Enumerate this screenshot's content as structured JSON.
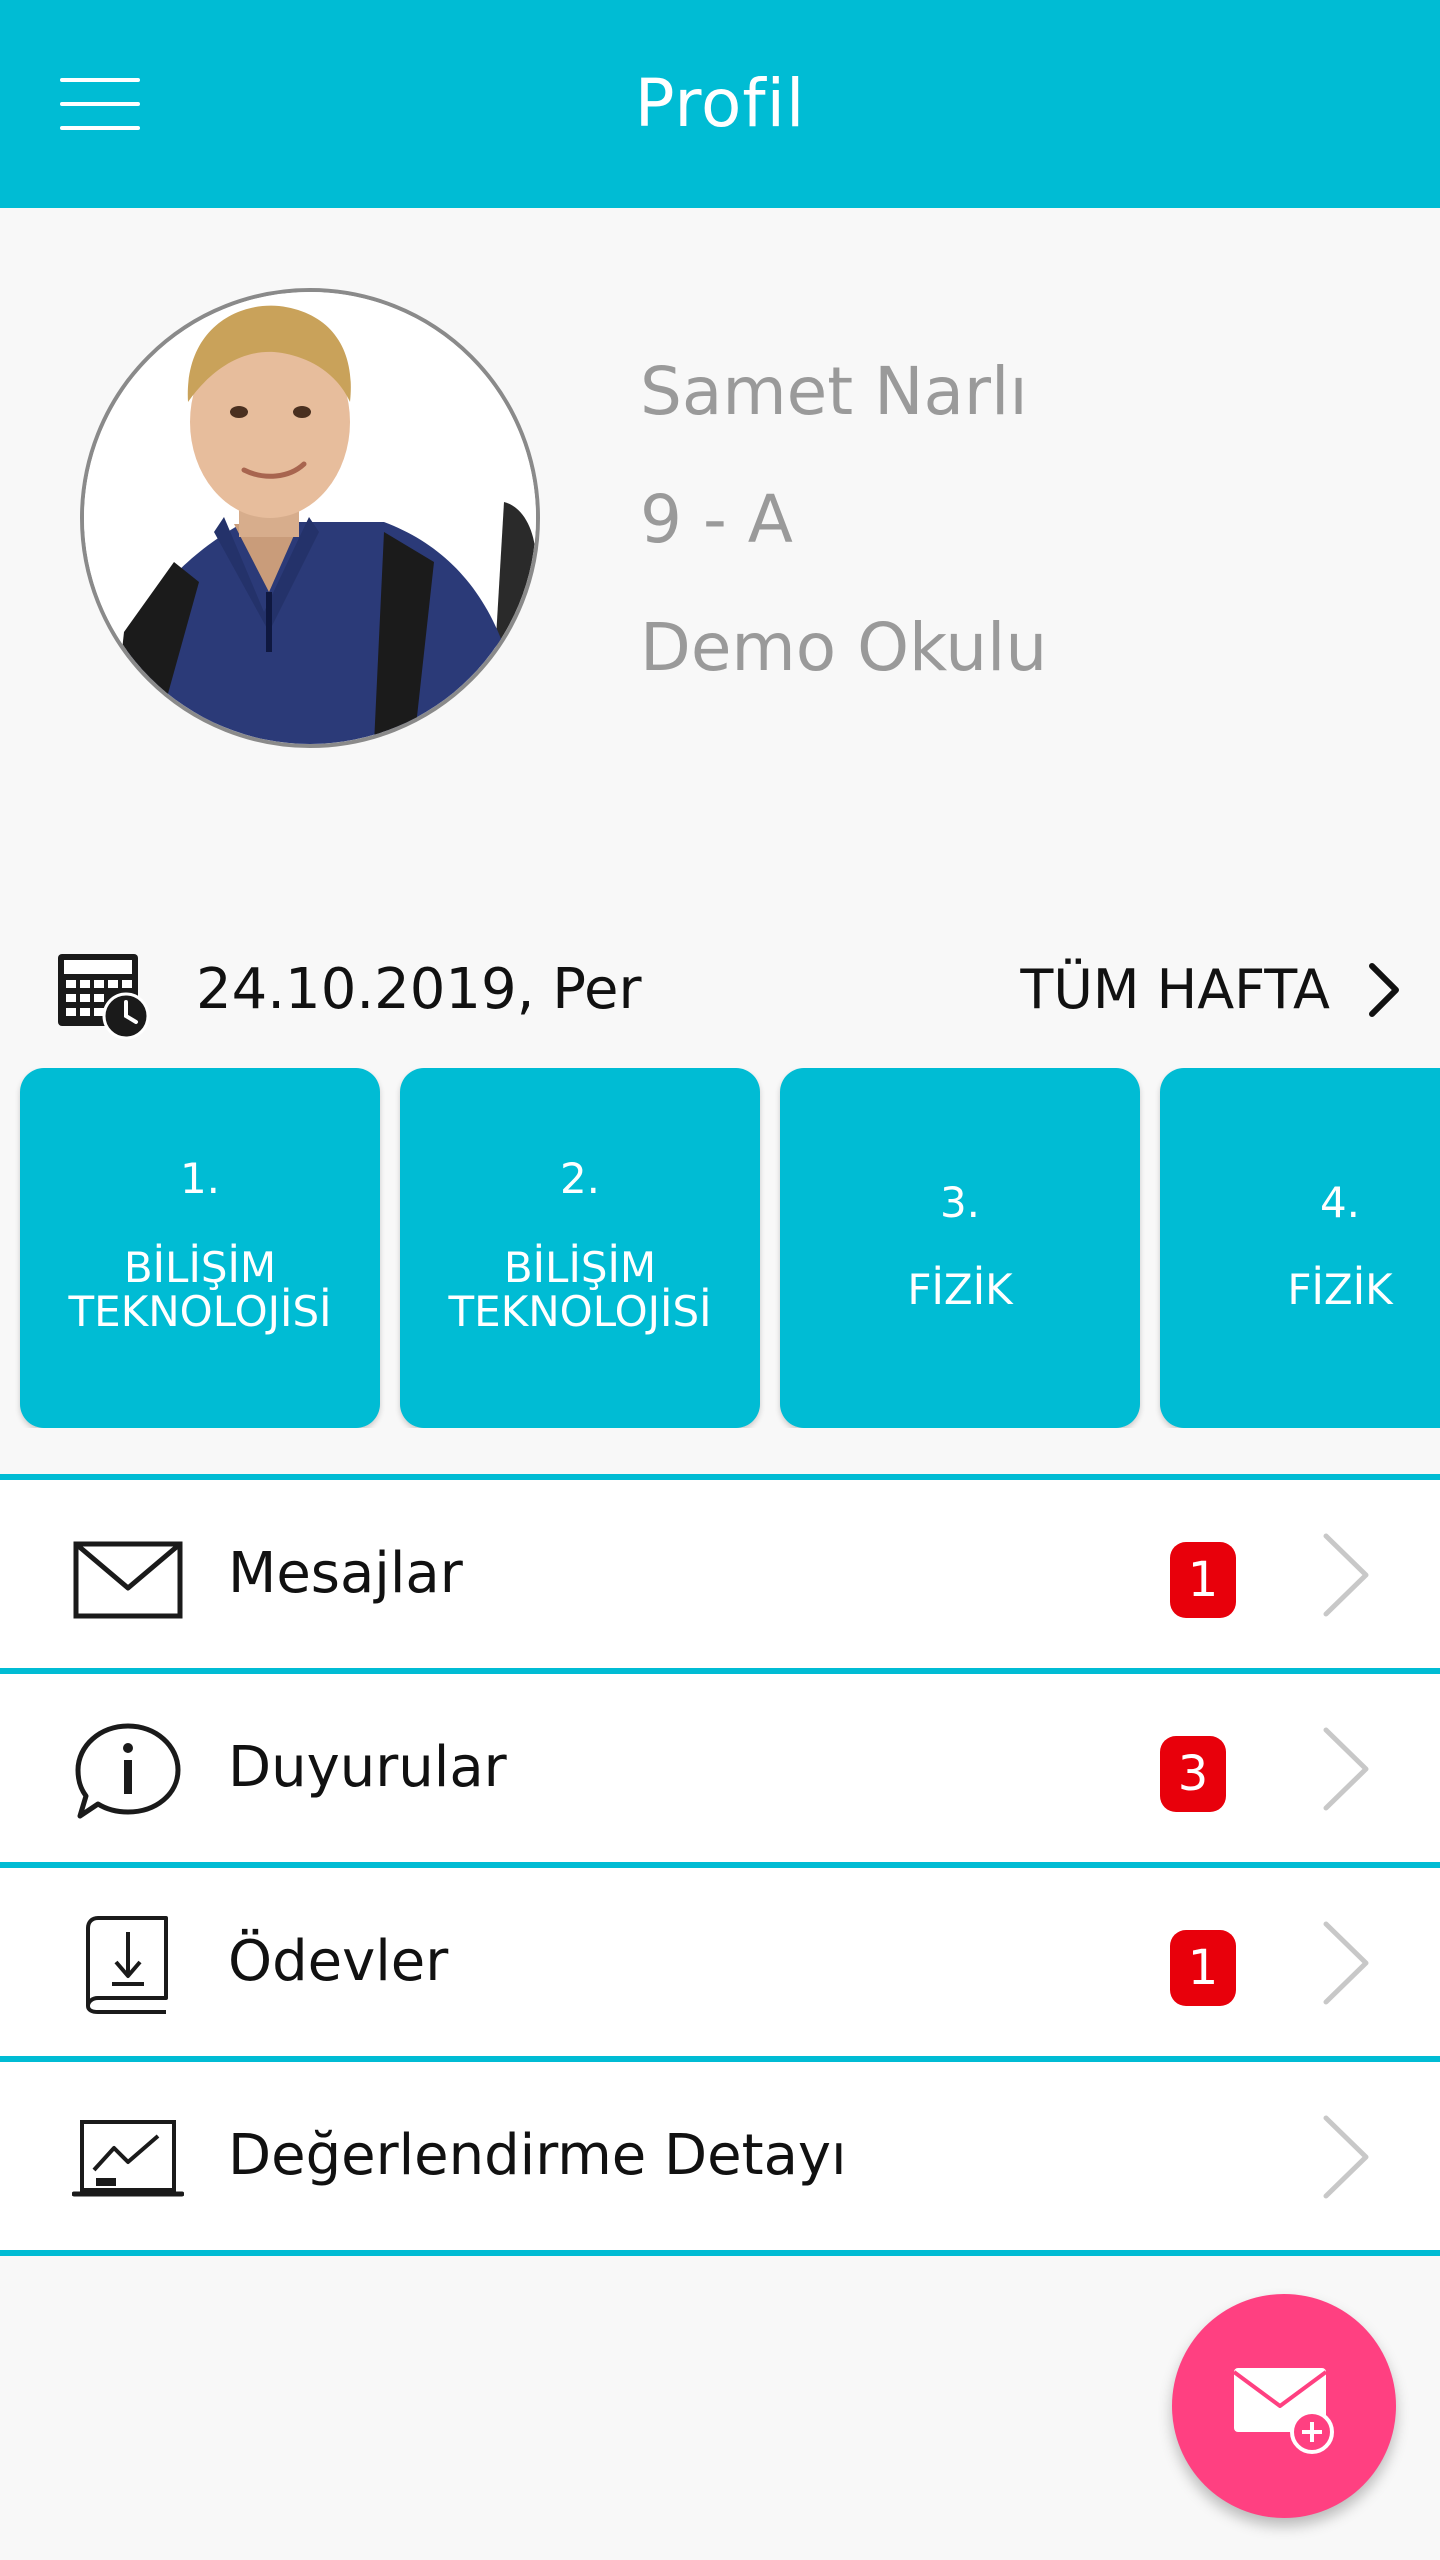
{
  "app_bar": {
    "title": "Profil",
    "menu_icon": "hamburger-icon"
  },
  "profile": {
    "name": "Samet Narlı",
    "class": "9 - A",
    "school": "Demo Okulu",
    "avatar_icon": "student-photo"
  },
  "schedule": {
    "date": "24.10.2019, Per",
    "week_link": "TÜM HAFTA",
    "calendar_icon": "calendar-clock-icon",
    "lessons": [
      {
        "number": "1.",
        "name": "BİLİŞİM\nTEKNOLOJİSİ"
      },
      {
        "number": "2.",
        "name": "BİLİŞİM\nTEKNOLOJİSİ"
      },
      {
        "number": "3.",
        "name": "FİZİK"
      },
      {
        "number": "4.",
        "name": "FİZİK"
      }
    ]
  },
  "menu": [
    {
      "label": "Mesajlar",
      "badge": "1",
      "icon": "envelope-icon"
    },
    {
      "label": "Duyurular",
      "badge": "3",
      "icon": "info-bubble-icon"
    },
    {
      "label": "Ödevler",
      "badge": "1",
      "icon": "book-download-icon"
    },
    {
      "label": "Değerlendirme Detayı",
      "badge": "",
      "icon": "chart-board-icon"
    }
  ],
  "fab": {
    "icon": "compose-message-icon"
  },
  "colors": {
    "primary": "#00bcd4",
    "badge": "#e8000b",
    "fab": "#ff4081",
    "muted_text": "#9a9a9a"
  }
}
